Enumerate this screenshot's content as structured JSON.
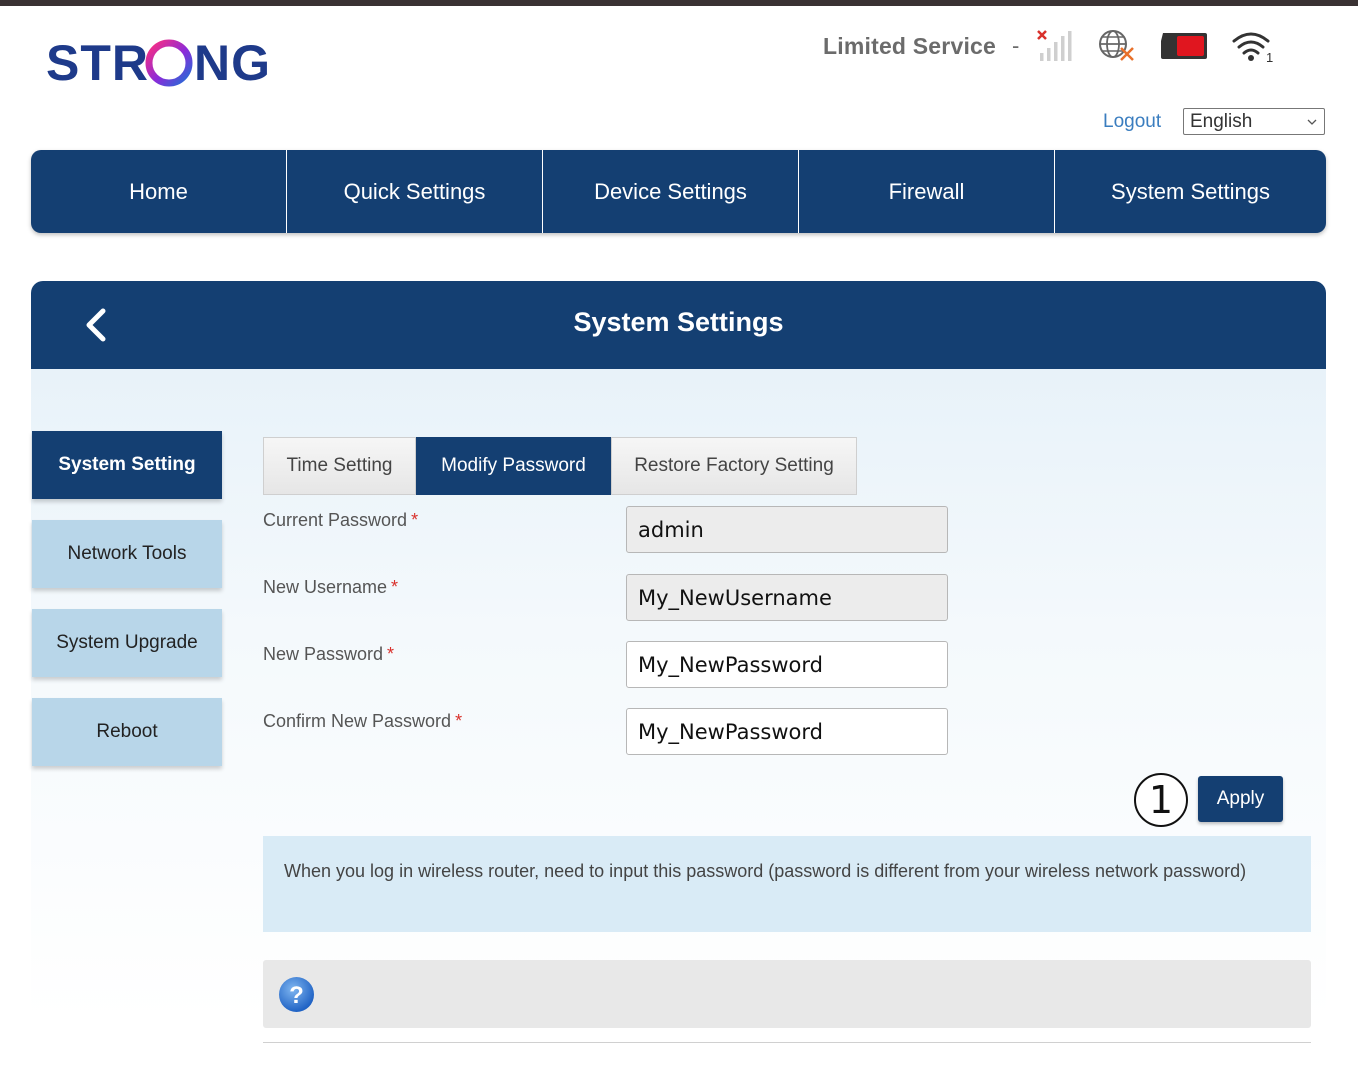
{
  "brand": {
    "logo_text": "STRONG"
  },
  "status": {
    "service_text": "Limited Service",
    "separator": "-",
    "icons": [
      "no-signal-icon",
      "no-internet-globe-icon",
      "sim-card-icon",
      "wifi-icon"
    ],
    "wifi_clients": "1"
  },
  "header": {
    "logout_label": "Logout",
    "language_selected": "English"
  },
  "main_nav": {
    "items": [
      {
        "label": "Home"
      },
      {
        "label": "Quick Settings"
      },
      {
        "label": "Device Settings"
      },
      {
        "label": "Firewall"
      },
      {
        "label": "System Settings"
      }
    ]
  },
  "panel": {
    "title": "System Settings"
  },
  "sidebar": {
    "items": [
      {
        "label": "System Setting",
        "active": true
      },
      {
        "label": "Network Tools"
      },
      {
        "label": "System Upgrade"
      },
      {
        "label": "Reboot"
      }
    ]
  },
  "tabs": [
    {
      "label": "Time Setting"
    },
    {
      "label": "Modify Password",
      "active": true
    },
    {
      "label": "Restore Factory Setting"
    }
  ],
  "form": {
    "required_mark": "*",
    "fields": [
      {
        "label": "Current Password",
        "value": "admin"
      },
      {
        "label": "New Username",
        "value": "My_NewUsername"
      },
      {
        "label": "New Password",
        "value": "My_NewPassword"
      },
      {
        "label": "Confirm New Password",
        "value": "My_NewPassword"
      }
    ],
    "callout_number": "1",
    "apply_label": "Apply"
  },
  "info_note": "When you log in wireless router, need to input this password (password is different from your wireless network password)",
  "help": {
    "icon": "question-icon",
    "symbol": "?"
  },
  "colors": {
    "primary": "#143f72",
    "sidebar_inactive": "#b8d6e9",
    "note_bg": "#d9ebf6",
    "link": "#3a7dbf",
    "required": "#d9302b",
    "logo_blue": "#1e3a8a",
    "logo_pink": "#e6007e"
  }
}
